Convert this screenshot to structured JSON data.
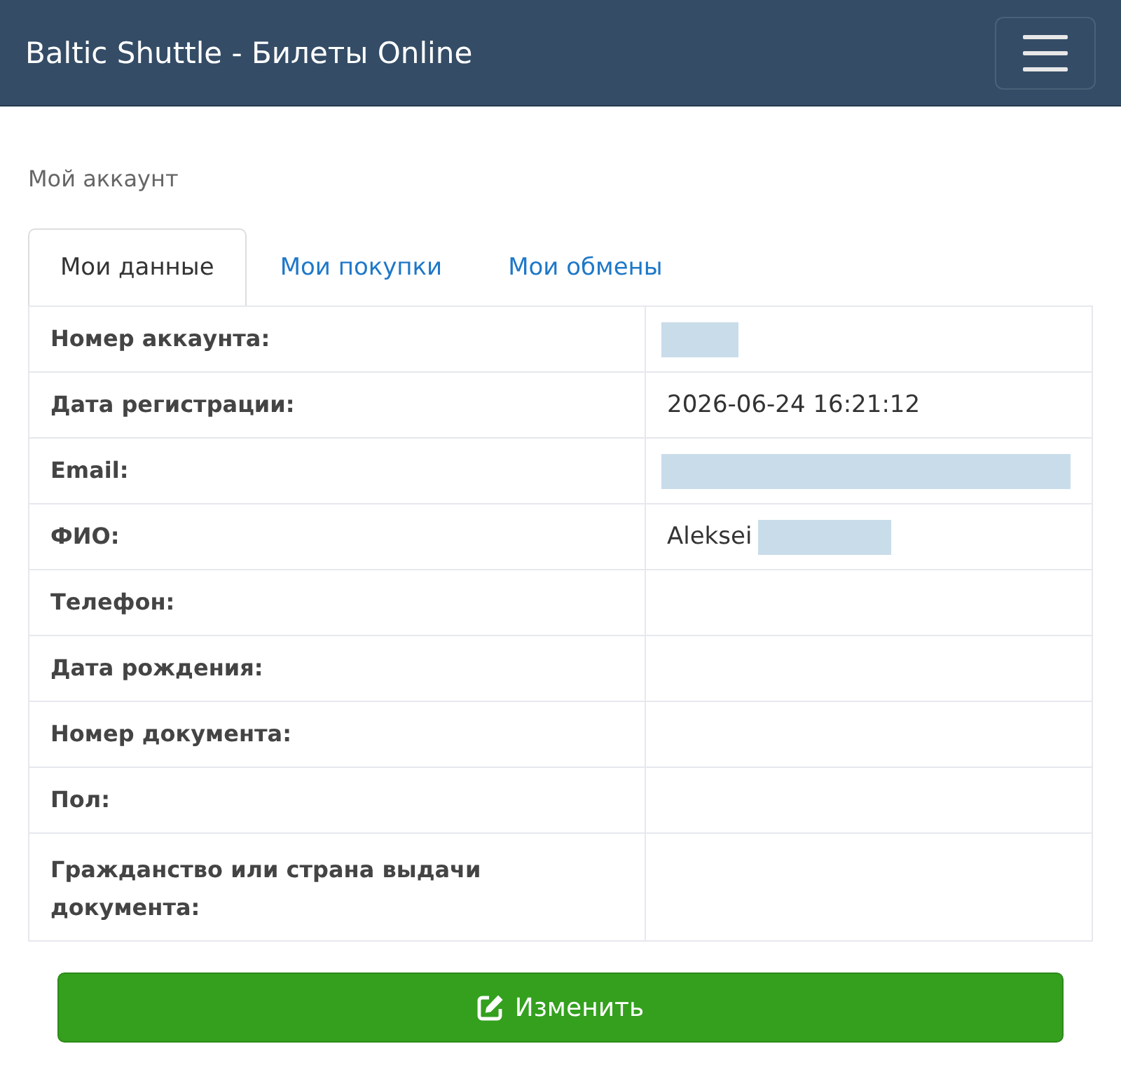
{
  "navbar": {
    "title": "Baltic Shuttle - Билеты Online"
  },
  "page_heading": "Мой аккаунт",
  "tabs": [
    {
      "label": "Мои данные",
      "selected": true
    },
    {
      "label": "Мои покупки",
      "selected": false
    },
    {
      "label": "Мои обмены",
      "selected": false
    }
  ],
  "table": {
    "rows": [
      {
        "label": "Номер аккаунта:",
        "value": [
          {
            "kind": "shortmask"
          }
        ]
      },
      {
        "label": "Дата регистрации:",
        "value": [
          {
            "kind": "text",
            "text": "2026-06-24 16:21:12"
          }
        ]
      },
      {
        "label": "Email:",
        "value": [
          {
            "kind": "widemask"
          }
        ]
      },
      {
        "label": "ФИО:",
        "value": [
          {
            "kind": "text",
            "text": "Aleksei"
          },
          {
            "kind": "mask"
          }
        ]
      },
      {
        "label": "Телефон:"
      },
      {
        "label": "Дата рождения:"
      },
      {
        "label": "Номер документа:"
      },
      {
        "label": "Пол:"
      },
      {
        "label": "Гражданство или страна выдачи документа:"
      }
    ]
  },
  "edit_button": {
    "label": "Изменить"
  }
}
